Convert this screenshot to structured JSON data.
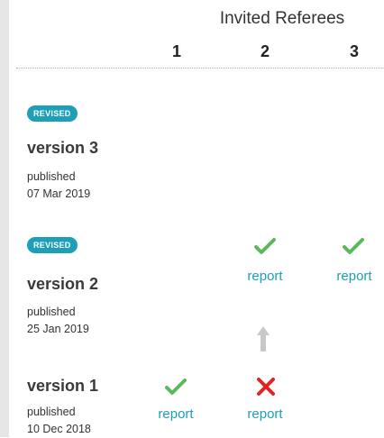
{
  "header": {
    "title": "Invited Referees",
    "columns": [
      "1",
      "2",
      "3"
    ]
  },
  "versions": [
    {
      "badge": "REVISED",
      "title": "version 3",
      "published_label": "published",
      "date": "07 Mar 2019"
    },
    {
      "badge": "REVISED",
      "title": "version 2",
      "published_label": "published",
      "date": "25 Jan 2019"
    },
    {
      "title": "version 1",
      "published_label": "published",
      "date": "10 Dec 2018"
    }
  ],
  "reports": {
    "v2_r2": {
      "status": "approved",
      "link": "report"
    },
    "v2_r3": {
      "status": "approved",
      "link": "report"
    },
    "v1_r1": {
      "status": "approved",
      "link": "report"
    },
    "v1_r2": {
      "status": "not-approved",
      "link": "report"
    }
  },
  "colors": {
    "accent": "#1d9fb8",
    "approved": "#5cb85c",
    "rejected": "#e02424",
    "arrow": "#c8c8c8"
  },
  "icons": [
    "check-icon",
    "cross-icon",
    "up-arrow-icon"
  ]
}
